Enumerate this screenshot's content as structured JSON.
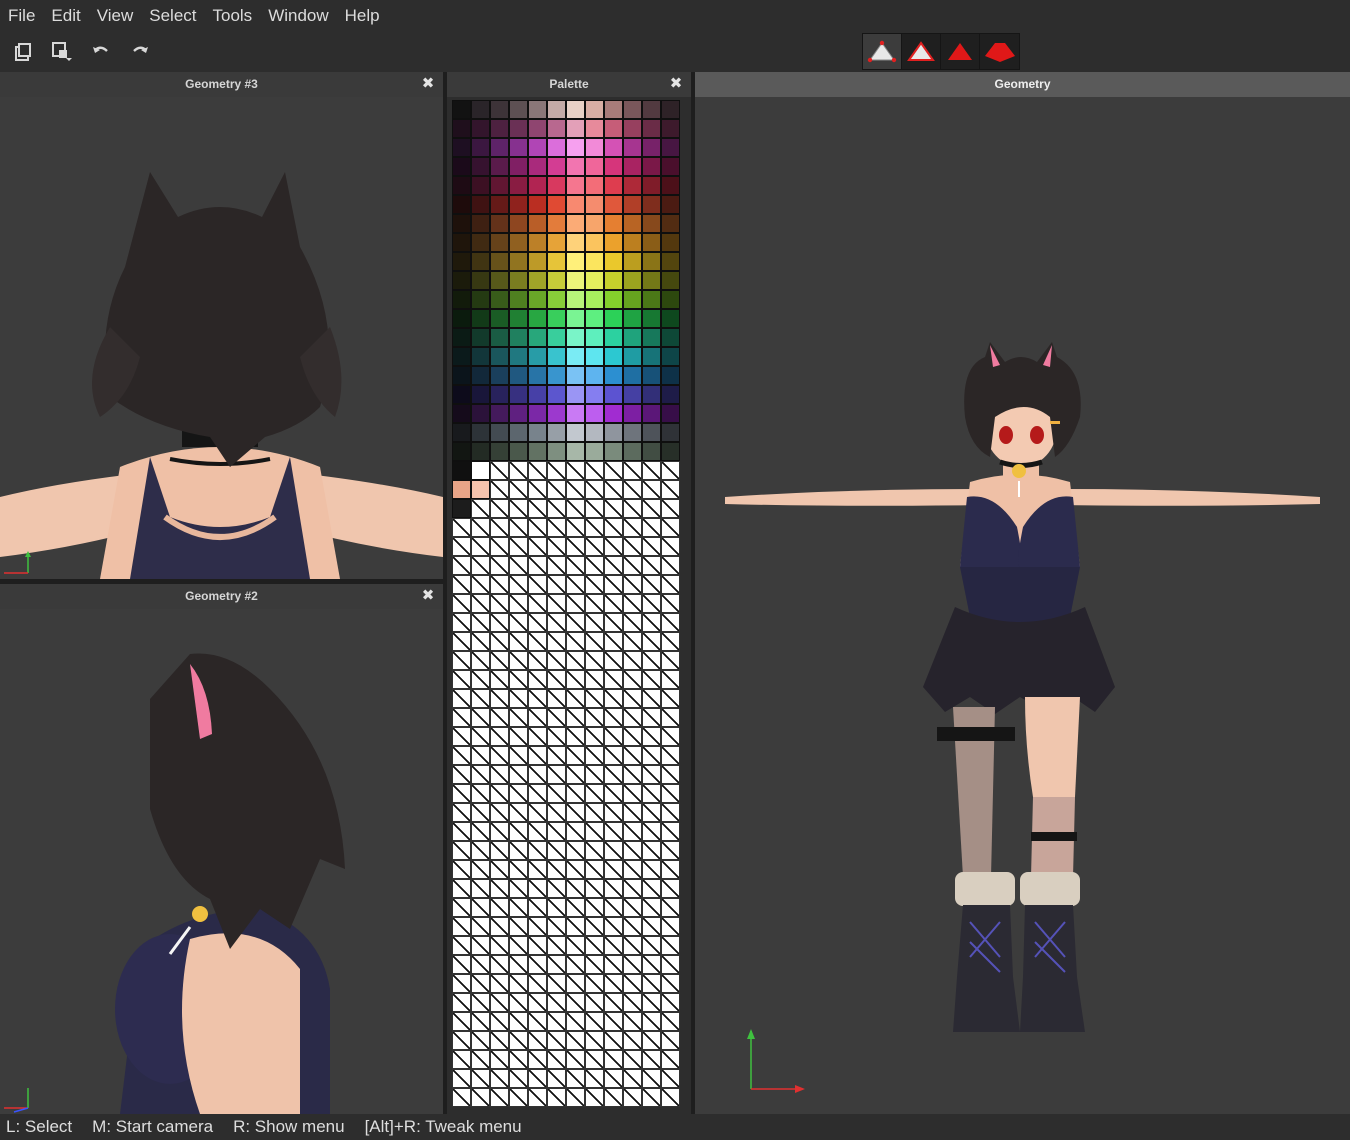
{
  "menu": [
    "File",
    "Edit",
    "View",
    "Select",
    "Tools",
    "Window",
    "Help"
  ],
  "toolbar": {
    "left_buttons": [
      "copy-icon",
      "paste-dropdown-icon",
      "undo-icon",
      "redo-icon"
    ],
    "mode_buttons": [
      "vertex-mode-icon",
      "edge-mode-icon",
      "face-mode-icon",
      "object-mode-icon"
    ]
  },
  "panels": {
    "geometry3": {
      "title": "Geometry #3",
      "close": "✖"
    },
    "geometry2": {
      "title": "Geometry #2",
      "close": "✖"
    },
    "palette": {
      "title": "Palette",
      "close": "✖"
    },
    "geometry": {
      "title": "Geometry"
    }
  },
  "palette": {
    "columns": 12,
    "colors": [
      [
        "#121212",
        "#2a2429",
        "#3d3338",
        "#5d5053",
        "#8a7778",
        "#c4aba7",
        "#e8d1c6",
        "#d8aea4",
        "#a87c7a",
        "#7a575b",
        "#523a40",
        "#2e2227"
      ],
      [
        "#1f0f1c",
        "#33152c",
        "#4d2140",
        "#6a3055",
        "#8f4570",
        "#b8688f",
        "#e3a0b8",
        "#e78a9b",
        "#c65d78",
        "#97405f",
        "#6a2c47",
        "#3d1a2c"
      ],
      [
        "#1e0f22",
        "#3b1740",
        "#5e2368",
        "#86318f",
        "#b045b5",
        "#db6edb",
        "#f6a0ef",
        "#f28ad8",
        "#d452b5",
        "#a63590",
        "#772269",
        "#471642"
      ],
      [
        "#1b0a1a",
        "#36122f",
        "#5a1b4b",
        "#801f64",
        "#a92a7c",
        "#d33d93",
        "#f275b0",
        "#f0669a",
        "#d6357b",
        "#a92362",
        "#7a1848",
        "#4a0f2c"
      ],
      [
        "#1e0b14",
        "#3c1023",
        "#611632",
        "#891c42",
        "#b12452",
        "#d8395f",
        "#f5768f",
        "#f36d78",
        "#de3d4f",
        "#ae2938",
        "#7f1c29",
        "#4c1019"
      ],
      [
        "#1e0b0b",
        "#3f1212",
        "#651a18",
        "#8f221d",
        "#ba2e22",
        "#e04a33",
        "#f88970",
        "#f58c6e",
        "#e0583b",
        "#b13f28",
        "#7f2d1d",
        "#4b1b12"
      ],
      [
        "#1e110b",
        "#3e2012",
        "#64321a",
        "#8e4620",
        "#b95e28",
        "#e37c3b",
        "#fbab76",
        "#f7a56b",
        "#e57f31",
        "#b86424",
        "#87491c",
        "#522c12"
      ],
      [
        "#1f150b",
        "#402a12",
        "#66421a",
        "#906020",
        "#bc8028",
        "#e6a338",
        "#fed27a",
        "#fbc45e",
        "#eba12c",
        "#bc7f1f",
        "#8a5d17",
        "#53380e"
      ],
      [
        "#1f190b",
        "#403412",
        "#67521a",
        "#917420",
        "#bd9a28",
        "#e6c439",
        "#fff07a",
        "#fbe55e",
        "#eac82c",
        "#bb9e1f",
        "#8a7417",
        "#53450e"
      ],
      [
        "#1b1b0b",
        "#373812",
        "#57591a",
        "#7a7d20",
        "#a0a428",
        "#c6cc39",
        "#ecf47a",
        "#e4ef5e",
        "#c6d12c",
        "#9ba31f",
        "#737817",
        "#45480e"
      ],
      [
        "#121b0b",
        "#243a12",
        "#385c1a",
        "#4f8020",
        "#69a728",
        "#88ce39",
        "#b8f47a",
        "#a8ef5e",
        "#84d12c",
        "#66a31f",
        "#4b7817",
        "#2d480e"
      ],
      [
        "#0b1b0d",
        "#123a18",
        "#1a5c25",
        "#208033",
        "#28a742",
        "#39ce5c",
        "#7af493",
        "#5eef80",
        "#2cd158",
        "#1fa343",
        "#177832",
        "#0e481e"
      ],
      [
        "#0b1b15",
        "#123a2b",
        "#1a5c44",
        "#20805f",
        "#28a77b",
        "#39ce9c",
        "#7af4c8",
        "#5eefbd",
        "#2cd1a0",
        "#1fa37c",
        "#17785b",
        "#0e4837"
      ],
      [
        "#0b1a1b",
        "#12363a",
        "#1a565c",
        "#207880",
        "#289ca7",
        "#39c3ce",
        "#7aebf4",
        "#5ee5ef",
        "#2cc8d1",
        "#1f9ca3",
        "#177378",
        "#0e4548"
      ],
      [
        "#0b141b",
        "#12283a",
        "#1a3f5c",
        "#205880",
        "#2874a7",
        "#3995ce",
        "#7ac2f4",
        "#5eb4ef",
        "#2c8fd1",
        "#1f6fa3",
        "#175178",
        "#0e3148"
      ],
      [
        "#0d0b1b",
        "#19163a",
        "#28225c",
        "#373080",
        "#4740a7",
        "#5c56ce",
        "#9a95f4",
        "#857ef0",
        "#5c53d1",
        "#4540a3",
        "#322f78",
        "#1e1c48"
      ],
      [
        "#150b1b",
        "#2b123a",
        "#441a5c",
        "#5f2080",
        "#7b28a7",
        "#9c39ce",
        "#c97af4",
        "#bd5eef",
        "#a12cd1",
        "#7d1fa3",
        "#5b1778",
        "#370e48"
      ],
      [
        "#181a1d",
        "#2d3338",
        "#434b52",
        "#5c666e",
        "#78838c",
        "#979fa7",
        "#c2c8cf",
        "#b3b8c0",
        "#8f959e",
        "#6e747c",
        "#4e535a",
        "#2f3237"
      ],
      [
        "#121612",
        "#232b24",
        "#354036",
        "#4a584b",
        "#627263",
        "#7e8f80",
        "#a7b7a8",
        "#9aab9b",
        "#7a8b7c",
        "#5c6b5e",
        "#414d43",
        "#272f28"
      ]
    ],
    "custom_row_1": [
      "#101010",
      "#ffffff"
    ],
    "custom_row_2": [
      "#e8a487",
      "#f5c3ad"
    ],
    "custom_row_3": [
      "#1c1c1c"
    ],
    "empty_rows": 32
  },
  "statusbar": [
    "L: Select",
    "M: Start camera",
    "R: Show menu",
    "[Alt]+R: Tweak menu"
  ],
  "colors": {
    "menubar_bg": "#2d2d2d",
    "panel_bg": "#3c3c3c",
    "axis_x": "#e03030",
    "axis_y": "#3fc03f",
    "hair": "#2b2626",
    "skin": "#f0c6ae",
    "dress": "#2a2a44"
  }
}
